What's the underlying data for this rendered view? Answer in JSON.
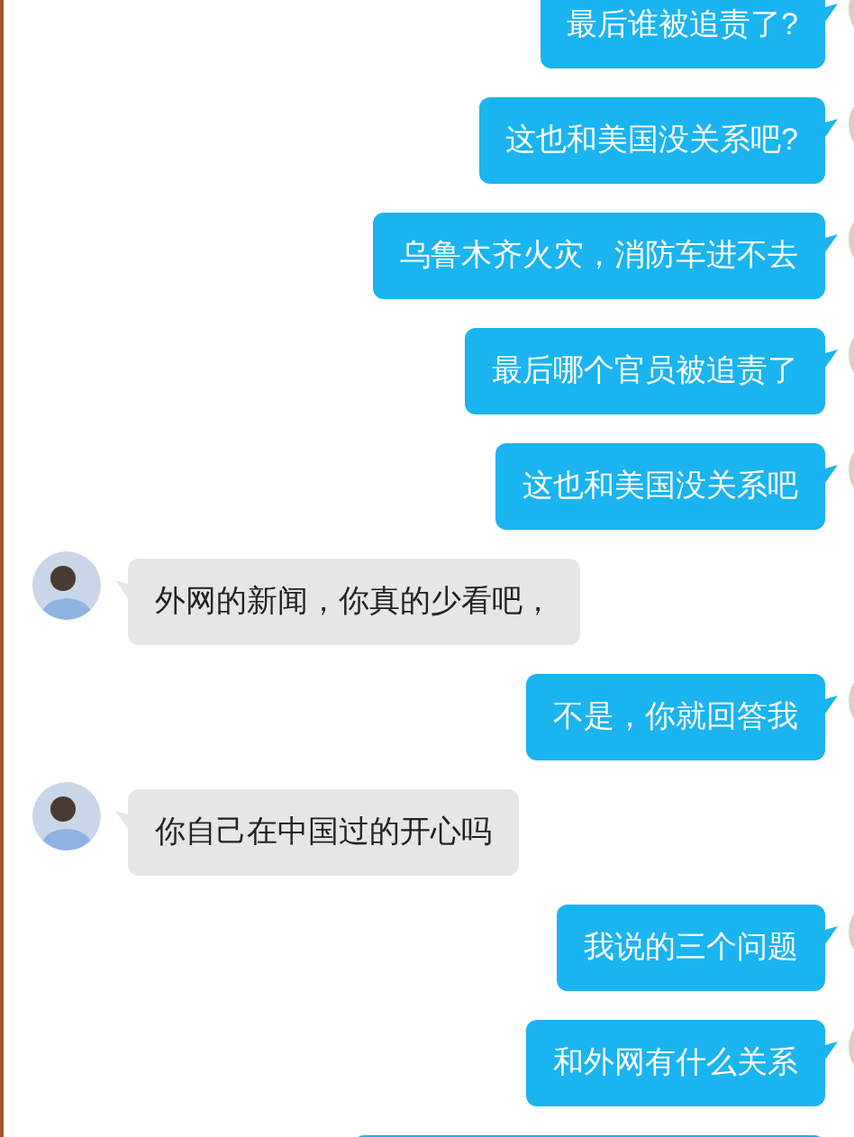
{
  "messages": [
    {
      "kind": "sent",
      "text": "最后谁被追责了?"
    },
    {
      "kind": "sent",
      "text": "这也和美国没关系吧?"
    },
    {
      "kind": "sent",
      "text": "乌鲁木齐火灾，消防车进不去"
    },
    {
      "kind": "sent",
      "text": "最后哪个官员被追责了"
    },
    {
      "kind": "sent",
      "text": "这也和美国没关系吧"
    },
    {
      "kind": "received",
      "text": "外网的新闻，你真的少看吧，"
    },
    {
      "kind": "sent",
      "text": "不是，你就回答我"
    },
    {
      "kind": "received",
      "text": "你自己在中国过的开心吗"
    },
    {
      "kind": "sent",
      "text": "我说的三个问题"
    },
    {
      "kind": "sent",
      "text": "和外网有什么关系"
    },
    {
      "kind": "sent"
    }
  ]
}
